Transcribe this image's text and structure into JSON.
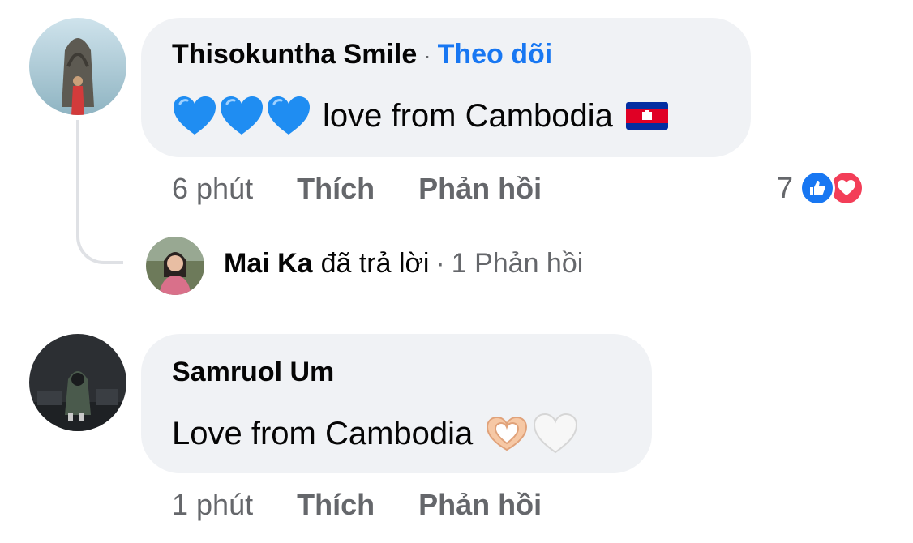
{
  "comments": [
    {
      "author": "Thisokuntha Smile",
      "separator": "·",
      "follow_label": "Theo dõi",
      "text": "love from Cambodia",
      "emoji_prefix": [
        "blue-heart",
        "blue-heart",
        "blue-heart"
      ],
      "emoji_suffix": [
        "cambodia-flag"
      ],
      "time": "6 phút",
      "like_label": "Thích",
      "reply_label": "Phản hồi",
      "reaction_count": "7",
      "reaction_icons": [
        "like-icon",
        "love-icon"
      ],
      "reply_preview": {
        "author": "Mai Ka",
        "verb": "đã trả lời",
        "separator": "·",
        "count_text": "1 Phản hồi"
      }
    },
    {
      "author": "Samruol Um",
      "text": "Love from Cambodia",
      "emoji_suffix": [
        "heart-hands",
        "white-heart"
      ],
      "time": "1 phút",
      "like_label": "Thích",
      "reply_label": "Phản hồi"
    }
  ],
  "colors": {
    "bubble": "#f0f2f5",
    "link_blue": "#1877f2",
    "meta_gray": "#65676b",
    "like_blue": "#1877f2",
    "love_red": "#f33e58"
  }
}
